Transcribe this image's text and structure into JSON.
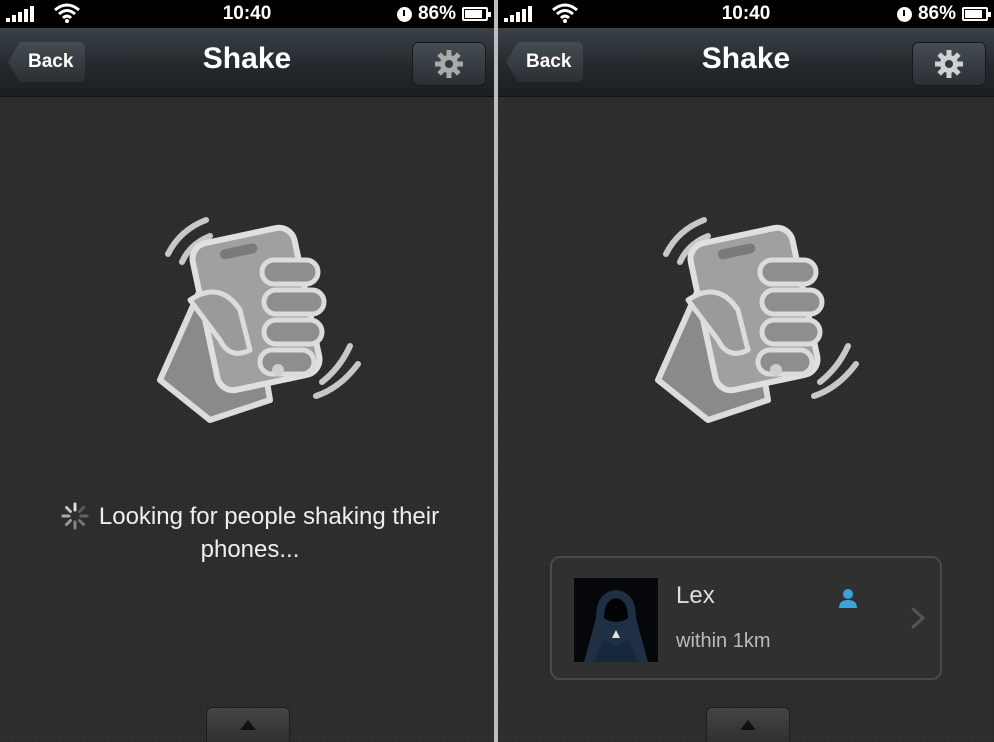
{
  "status_bar": {
    "time": "10:40",
    "battery": "86%",
    "battery_level": 0.86
  },
  "left": {
    "nav": {
      "back_label": "Back",
      "title": "Shake"
    },
    "searching_text": "Looking for people shaking their phones..."
  },
  "right": {
    "nav": {
      "back_label": "Back",
      "title": "Shake"
    },
    "result": {
      "name": "Lex",
      "distance": "within 1km"
    }
  },
  "icons": {
    "signal": "signal-icon",
    "wifi": "wifi-icon",
    "alarm": "alarm-icon",
    "battery": "battery-icon",
    "settings": "gear-icon",
    "shake": "shake-hand-icon",
    "spinner": "spinner-icon",
    "person": "person-icon",
    "chevron": "chevron-right-icon",
    "drawer": "triangle-up-icon"
  },
  "colors": {
    "accent": "#3aa3dc",
    "background": "#2b2b2b",
    "nav": "#24292d"
  }
}
